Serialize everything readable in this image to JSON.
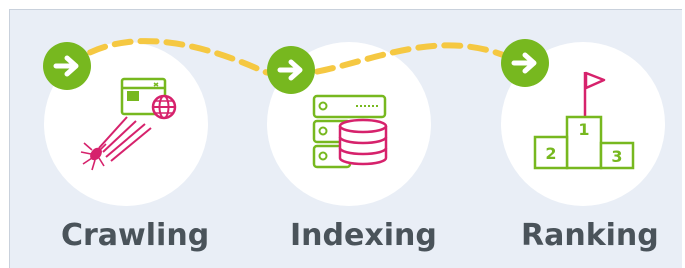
{
  "steps": [
    {
      "label": "Crawling",
      "icon": "spider-browser-icon"
    },
    {
      "label": "Indexing",
      "icon": "server-database-icon"
    },
    {
      "label": "Ranking",
      "icon": "podium-flag-icon"
    }
  ],
  "podium": {
    "first": "1",
    "second": "2",
    "third": "3"
  },
  "colors": {
    "background": "#e9eef6",
    "circle": "#ffffff",
    "accent_green": "#77b81f",
    "accent_pink": "#d6226c",
    "dash_yellow": "#f5c842",
    "text": "#4a535a"
  }
}
